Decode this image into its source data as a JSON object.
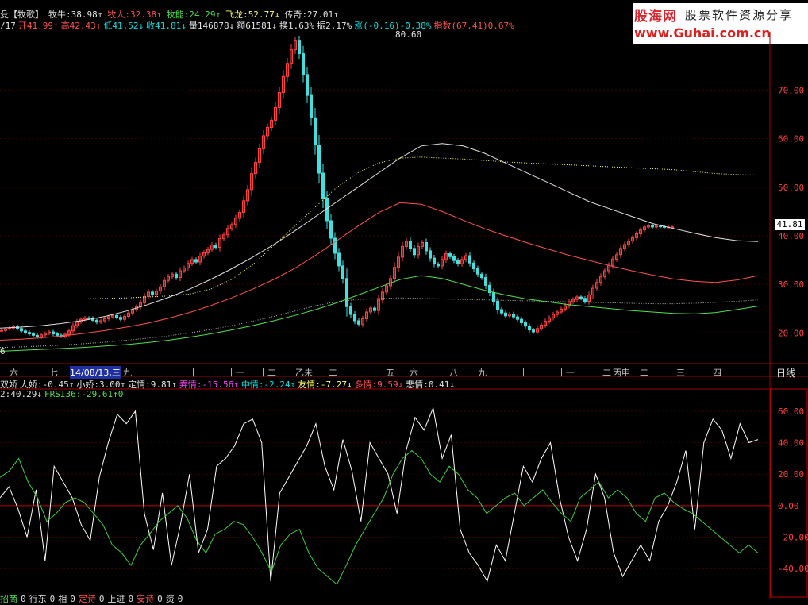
{
  "header_line1": [
    {
      "t": "殳【牧歌】",
      "c": "c-w"
    },
    {
      "t": "牧牛:38.98↑",
      "c": "c-w"
    },
    {
      "t": "牧人:32.38↑",
      "c": "c-r"
    },
    {
      "t": "牧能:24.29↑",
      "c": "c-g"
    },
    {
      "t": "飞龙:52.77↓",
      "c": "c-y"
    },
    {
      "t": "传奇:27.01↑",
      "c": "c-w"
    }
  ],
  "header_line2": [
    {
      "t": "/17",
      "c": "c-w"
    },
    {
      "t": "开41.99↑",
      "c": "c-r"
    },
    {
      "t": "高42.43↑",
      "c": "c-r"
    },
    {
      "t": "低41.52↓",
      "c": "c-c"
    },
    {
      "t": "收41.81↓",
      "c": "c-c"
    },
    {
      "t": "量146878↓",
      "c": "c-w"
    },
    {
      "t": "额61581↓",
      "c": "c-w"
    },
    {
      "t": "换1.63%",
      "c": "c-w"
    },
    {
      "t": "振2.17%",
      "c": "c-w"
    },
    {
      "t": "涨(-0.16)-0.38%",
      "c": "c-c"
    },
    {
      "t": "指数(67.41)0.67%",
      "c": "c-r"
    }
  ],
  "watermark": {
    "logo": "股海网",
    "slogan": "股票软件资源分享",
    "url": "www.Guhai.com.cn"
  },
  "peak_label": "80.60",
  "last_price": "41.81",
  "left_edge_label": "6",
  "date_axis": [
    "六",
    "七",
    "14/08/13,三",
    "九",
    "十",
    "十一",
    "十二",
    "乙未",
    "二",
    "五",
    "六",
    "八",
    "九",
    "十",
    "十一",
    "十二",
    "丙申",
    "二",
    "三",
    "四"
  ],
  "period_label": "日线",
  "indicator_header": [
    {
      "t": "双娇",
      "c": "c-w"
    },
    {
      "t": "大娇:-0.45↑",
      "c": "c-w"
    },
    {
      "t": "小娇:3.00↑",
      "c": "c-w"
    },
    {
      "t": "定情:9.81↑",
      "c": "c-w"
    },
    {
      "t": "弄情:-15.56↑",
      "c": "c-m"
    },
    {
      "t": "中情:-2.24↑",
      "c": "c-c"
    },
    {
      "t": "友情:-7.27↓",
      "c": "c-y"
    },
    {
      "t": "多情:9.59↓",
      "c": "c-r"
    },
    {
      "t": "悲情:0.41↓",
      "c": "c-w"
    }
  ],
  "indicator_header2": [
    {
      "t": "2:40.29↓",
      "c": "c-w"
    },
    {
      "t": "FRSI36:-29.61↑0",
      "c": "c-g"
    }
  ],
  "bottom_partial": [
    {
      "t": "招商",
      "c": "c-g"
    },
    {
      "t": "0",
      "c": "c-w"
    },
    {
      "t": "行东",
      "c": "c-w"
    },
    {
      "t": "0",
      "c": "c-w"
    },
    {
      "t": "相",
      "c": "c-w"
    },
    {
      "t": "0",
      "c": "c-w"
    },
    {
      "t": "定诗",
      "c": "c-r"
    },
    {
      "t": "0",
      "c": "c-w"
    },
    {
      "t": "上进",
      "c": "c-w"
    },
    {
      "t": "0",
      "c": "c-w"
    },
    {
      "t": "安诗",
      "c": "c-r"
    },
    {
      "t": "0",
      "c": "c-w"
    },
    {
      "t": "资",
      "c": "c-w"
    },
    {
      "t": "0",
      "c": "c-w"
    }
  ],
  "chart_data": [
    {
      "type": "candlestick",
      "y_ticks": [
        "70.00",
        "60.00",
        "50.00",
        "40.00",
        "30.00",
        "20.00"
      ],
      "ylim": [
        14,
        82
      ],
      "x": [
        0,
        5,
        10,
        15,
        20,
        25,
        30,
        35,
        40,
        45,
        50,
        55,
        60,
        65,
        70,
        75,
        80,
        85,
        90,
        95,
        100,
        105,
        110,
        115,
        120,
        125,
        130,
        135,
        140,
        145,
        150,
        155,
        160,
        165,
        170,
        175,
        180,
        185,
        190,
        195,
        200,
        205,
        210,
        215,
        220,
        225,
        230,
        235,
        240,
        245,
        250,
        255,
        260,
        265,
        270,
        275,
        280,
        285,
        290,
        295,
        300,
        305,
        310,
        315,
        320,
        325,
        330,
        335,
        340,
        345,
        350,
        355,
        360,
        365,
        370,
        375,
        380,
        385,
        390,
        395,
        400,
        405,
        410,
        415,
        420,
        425,
        430,
        435,
        440,
        445,
        450,
        455,
        460,
        465,
        470,
        475,
        480,
        485,
        490,
        495,
        500,
        505,
        510,
        515,
        520,
        525,
        530,
        535,
        540,
        545,
        550,
        555,
        560,
        565,
        570,
        575,
        580,
        585,
        590,
        595,
        600,
        605,
        610,
        615,
        620,
        625,
        630,
        635,
        640,
        645,
        650,
        655,
        660,
        665,
        670,
        675,
        680,
        685,
        690,
        695,
        700,
        705,
        710,
        715,
        720,
        725,
        730,
        735,
        740,
        745,
        750,
        755,
        760,
        765,
        770,
        775,
        780,
        785,
        790,
        795,
        800,
        805,
        810,
        815,
        820,
        825,
        830,
        835,
        840,
        845,
        850,
        855,
        860,
        865,
        870,
        875,
        880,
        885,
        890,
        895,
        900,
        905,
        910,
        915,
        920,
        925,
        930,
        935,
        940,
        945,
        950,
        955
      ],
      "close": [
        20.5,
        20.8,
        21,
        21.3,
        20.9,
        20.4,
        20.1,
        19.8,
        19.5,
        19.2,
        19.6,
        19.9,
        20.2,
        19.8,
        19.5,
        19.3,
        19.7,
        20.4,
        21.5,
        22.3,
        22.8,
        23.1,
        23,
        22.6,
        22.2,
        22.5,
        22.9,
        23.3,
        23.6,
        23.2,
        22.8,
        23.4,
        24.1,
        24.8,
        25.4,
        26.2,
        27.5,
        28.4,
        27.9,
        28.6,
        29.5,
        30.8,
        31.6,
        32.1,
        31.4,
        32.8,
        33.4,
        34.3,
        35.1,
        34.6,
        35.8,
        36.5,
        37.2,
        38.1,
        37.6,
        39.4,
        40.2,
        41.5,
        42.3,
        43.6,
        44.8,
        47.2,
        49.5,
        52.8,
        55.1,
        57.9,
        60.6,
        62.3,
        63.8,
        66.4,
        69.5,
        72.8,
        75.5,
        78.3,
        80.1,
        77.5,
        73.2,
        68.9,
        64.3,
        58.7,
        52.9,
        47.6,
        43.1,
        39.5,
        36.4,
        33.8,
        31.2,
        25.4,
        23.8,
        22.5,
        21.8,
        22.9,
        24.3,
        25.1,
        24.6,
        26.8,
        28.4,
        29.7,
        31.2,
        33.5,
        35.6,
        37.8,
        38.9,
        37.4,
        36.1,
        37.8,
        38.6,
        36.9,
        35.4,
        34.2,
        33.8,
        35.1,
        36.3,
        35.7,
        34.9,
        34.2,
        35.1,
        35.9,
        34.4,
        33.2,
        32.1,
        31.4,
        29.8,
        28.3,
        26.5,
        24.8,
        24.1,
        23.5,
        23.9,
        23.3,
        22.8,
        22.1,
        21.4,
        20.6,
        20.2,
        20.9,
        21.6,
        22.4,
        23.1,
        23.8,
        24.3,
        24.9,
        25.6,
        26.4,
        26.9,
        27.4,
        27.1,
        26.5,
        27.8,
        29.2,
        30.4,
        31.6,
        32.8,
        33.9,
        35.2,
        36.1,
        37.4,
        38.2,
        38.9,
        39.6,
        40.4,
        41.2,
        41.8,
        42.1,
        41.8,
        42.0,
        41.9,
        41.81,
        41.81,
        41.81
      ],
      "series": [
        {
          "name": "牧牛",
          "color": "#e0e0e0",
          "values": [
            21,
            21.2,
            21.5,
            22,
            22.6,
            23.4,
            24.5,
            25.8,
            27.3,
            29,
            31,
            33.2,
            35.6,
            38.2,
            41,
            44,
            47,
            50,
            53,
            56,
            58.5,
            59,
            58.5,
            57,
            55,
            53,
            51,
            49,
            47,
            45.5,
            44,
            42.5,
            41.5,
            40.5,
            39.6,
            39,
            38.8
          ]
        },
        {
          "name": "牧人",
          "color": "#ff5050",
          "values": [
            18.5,
            18.7,
            19,
            19.4,
            19.9,
            20.5,
            21.2,
            22,
            23,
            24.2,
            25.6,
            27.2,
            29,
            31,
            33.3,
            36,
            39,
            42,
            44.8,
            46.8,
            46.5,
            45,
            43.2,
            41.5,
            40,
            38.6,
            37.3,
            36,
            34.9,
            33.8,
            32.8,
            31.9,
            31.1,
            30.6,
            30.4,
            30.9,
            31.8
          ]
        },
        {
          "name": "牧能",
          "color": "#50e050",
          "values": [
            16.2,
            16.4,
            16.6,
            16.8,
            17,
            17.3,
            17.6,
            18,
            18.5,
            19.1,
            19.8,
            20.6,
            21.5,
            22.5,
            23.6,
            24.8,
            26.2,
            27.8,
            29.4,
            31,
            31.8,
            31.2,
            30,
            28.8,
            27.8,
            27,
            26.4,
            25.8,
            25.4,
            25,
            24.6,
            24.3,
            24,
            23.9,
            24.2,
            24.8,
            25.5
          ]
        },
        {
          "name": "飞龙",
          "color": "#ffff66",
          "values": [
            27,
            27,
            27,
            27,
            27,
            27.1,
            27.2,
            27.4,
            27.6,
            28,
            29,
            31,
            34,
            38,
            42,
            46,
            50,
            53,
            55,
            56,
            56.2,
            56,
            55.8,
            55.5,
            55.2,
            55,
            54.8,
            54.6,
            54.4,
            54.2,
            54,
            53.8,
            53.6,
            53.2,
            52.8,
            52.6,
            52.5
          ]
        },
        {
          "name": "传奇",
          "color": "#c0c0c0",
          "values": [
            17,
            17.1,
            17.3,
            17.5,
            17.8,
            18.1,
            18.5,
            18.9,
            19.4,
            20,
            20.7,
            21.5,
            22.4,
            23.4,
            24.5,
            25.6,
            26.4,
            26.9,
            27.1,
            27.2,
            27.1,
            27,
            26.9,
            26.8,
            26.7,
            26.6,
            26.5,
            26.4,
            26.3,
            26.2,
            26.1,
            26.0,
            26.0,
            26.1,
            26.3,
            26.5,
            26.8
          ]
        }
      ]
    },
    {
      "type": "line",
      "y_ticks": [
        "60.00",
        "40.00",
        "20.00",
        "0.00",
        "-20.00",
        "-40.00"
      ],
      "ylim": [
        -52,
        68
      ],
      "series": [
        {
          "name": "大娇",
          "color": "#ffffff",
          "values": [
            5,
            12,
            -2,
            -20,
            10,
            -35,
            25,
            15,
            5,
            -12,
            -22,
            18,
            40,
            58,
            52,
            60,
            -5,
            -28,
            8,
            -38,
            -12,
            20,
            -30,
            -15,
            25,
            30,
            38,
            52,
            55,
            40,
            -48,
            8,
            18,
            28,
            38,
            52,
            25,
            10,
            42,
            22,
            -10,
            40,
            30,
            20,
            -5,
            35,
            56,
            48,
            62,
            30,
            45,
            -15,
            -30,
            -38,
            -48,
            -25,
            -35,
            -5,
            25,
            15,
            30,
            40,
            5,
            -20,
            -35,
            -15,
            20,
            5,
            -30,
            -45,
            -35,
            -25,
            -35,
            -10,
            0,
            15,
            35,
            -15,
            40,
            55,
            48,
            30,
            52,
            40,
            42
          ]
        },
        {
          "name": "FRSI36",
          "color": "#40d040",
          "values": [
            18,
            22,
            30,
            15,
            5,
            -10,
            -5,
            2,
            5,
            2,
            -5,
            -12,
            -25,
            -30,
            -38,
            -25,
            -18,
            -10,
            -5,
            0,
            -8,
            -22,
            -30,
            -18,
            -15,
            -10,
            -12,
            -20,
            -30,
            -42,
            -25,
            -18,
            -15,
            -30,
            -40,
            -45,
            -50,
            -38,
            -25,
            -15,
            -5,
            5,
            20,
            30,
            35,
            30,
            20,
            15,
            25,
            20,
            10,
            5,
            -5,
            0,
            5,
            8,
            0,
            5,
            10,
            2,
            -5,
            -10,
            5,
            10,
            15,
            5,
            10,
            5,
            -5,
            -10,
            5,
            8,
            2,
            -2,
            -5,
            -10,
            -15,
            -20,
            -25,
            -30,
            -25,
            -30
          ]
        }
      ]
    }
  ]
}
